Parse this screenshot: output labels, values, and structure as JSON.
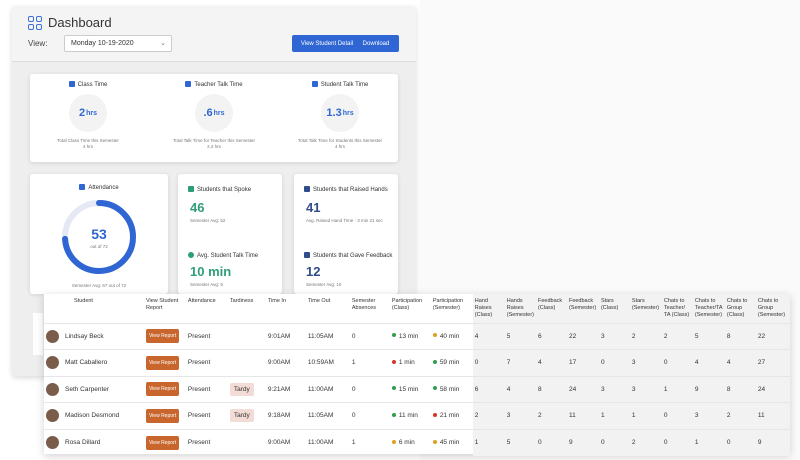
{
  "header": {
    "title": "Dashboard",
    "view_label": "View:",
    "view_value": "Monday 10-19-2020",
    "view_student_detail": "View Student Detail",
    "download": "Download"
  },
  "summary": [
    {
      "label": "Class Time",
      "value": "2",
      "unit": "hrs",
      "sub1": "Total Class Time this Semester",
      "sub2": "4 hrs",
      "icon": "calendar-icon"
    },
    {
      "label": "Teacher Talk Time",
      "value": ".6",
      "unit": "hrs",
      "sub1": "Total Talk Time for Teacher this Semester",
      "sub2": "2.2 hrs",
      "icon": "teacher-icon"
    },
    {
      "label": "Student Talk Time",
      "value": "1.3",
      "unit": "hrs",
      "sub1": "Total Talk Time for Students this Semester",
      "sub2": "4 hrs",
      "icon": "student-icon"
    }
  ],
  "attendance": {
    "label": "Attendance",
    "value": "53",
    "of": "out of 72",
    "sub": "Semester Avg: 67 out of 72",
    "fraction": 0.74,
    "color": "#2f66d4"
  },
  "spoke": {
    "label": "Students that Spoke",
    "value": "46",
    "sub": "Semester Avg: 52",
    "color": "#2e9e78"
  },
  "talk_time": {
    "label": "Avg. Student Talk Time",
    "value": "10 min",
    "sub": "Semester Avg: 9",
    "color": "#2e9e78"
  },
  "hands": {
    "label": "Students that Raised Hands",
    "value": "41",
    "sub": "Avg. Raised Hand Time - 3 min 21 sec",
    "color": "#2f4d8a"
  },
  "feedback": {
    "label": "Students that Gave Feedback",
    "value": "12",
    "sub": "Semester Avg: 10",
    "color": "#2f4d8a"
  },
  "table": {
    "columns": [
      "Student",
      "View Student Report",
      "Attendance",
      "Tardiness",
      "Time In",
      "Time Out",
      "Semester Absences",
      "Participation (Class)",
      "Participation (Semester)",
      "Hand Raises (Class)",
      "Hands Raises (Semester)",
      "Feedback (Class)",
      "Feedback (Semester)",
      "Stars (Class)",
      "Stars (Semester)",
      "Chats to Teacher/ TA (Class)",
      "Chats to Teacher/TA (Semester)",
      "Chats to Group (Class)",
      "Chats to Group (Semester)"
    ],
    "rows": [
      {
        "name": "Lindsay Beck",
        "report": "View Report",
        "attendance": "Present",
        "tardy": "",
        "time_in": "9:01AM",
        "time_out": "11:05AM",
        "absences": "0",
        "part_class": "13 min",
        "part_class_color": "#2e9e4f",
        "part_sem": "40 min",
        "part_sem_color": "#e0a020",
        "hr_c": "4",
        "hr_s": "5",
        "fb_c": "6",
        "fb_s": "22",
        "st_c": "3",
        "st_s": "2",
        "ct_c": "2",
        "ct_s": "5",
        "cg_c": "8",
        "cg_s": "22"
      },
      {
        "name": "Matt Caballero",
        "report": "View Report",
        "attendance": "Present",
        "tardy": "",
        "time_in": "9:00AM",
        "time_out": "10:59AM",
        "absences": "1",
        "part_class": "1 min",
        "part_class_color": "#d8342c",
        "part_sem": "59 min",
        "part_sem_color": "#2e9e4f",
        "hr_c": "0",
        "hr_s": "7",
        "fb_c": "4",
        "fb_s": "17",
        "st_c": "0",
        "st_s": "3",
        "ct_c": "0",
        "ct_s": "4",
        "cg_c": "4",
        "cg_s": "27"
      },
      {
        "name": "Seth Carpenter",
        "report": "View Report",
        "attendance": "Present",
        "tardy": "Tardy",
        "time_in": "9:21AM",
        "time_out": "11:00AM",
        "absences": "0",
        "part_class": "15 min",
        "part_class_color": "#2e9e4f",
        "part_sem": "58 min",
        "part_sem_color": "#2e9e4f",
        "hr_c": "6",
        "hr_s": "4",
        "fb_c": "8",
        "fb_s": "24",
        "st_c": "3",
        "st_s": "3",
        "ct_c": "1",
        "ct_s": "9",
        "cg_c": "8",
        "cg_s": "24"
      },
      {
        "name": "Madison Desmond",
        "report": "View Report",
        "attendance": "Present",
        "tardy": "Tardy",
        "time_in": "9:18AM",
        "time_out": "11:05AM",
        "absences": "0",
        "part_class": "11 min",
        "part_class_color": "#2e9e4f",
        "part_sem": "21 min",
        "part_sem_color": "#d8342c",
        "hr_c": "2",
        "hr_s": "3",
        "fb_c": "2",
        "fb_s": "11",
        "st_c": "1",
        "st_s": "1",
        "ct_c": "0",
        "ct_s": "3",
        "cg_c": "2",
        "cg_s": "11"
      },
      {
        "name": "Rosa Dillard",
        "report": "View Report",
        "attendance": "Present",
        "tardy": "",
        "time_in": "9:00AM",
        "time_out": "11:00AM",
        "absences": "1",
        "part_class": "6 min",
        "part_class_color": "#e0a020",
        "part_sem": "45 min",
        "part_sem_color": "#e0a020",
        "hr_c": "1",
        "hr_s": "5",
        "fb_c": "0",
        "fb_s": "9",
        "st_c": "0",
        "st_s": "2",
        "ct_c": "0",
        "ct_s": "1",
        "cg_c": "0",
        "cg_s": "9"
      }
    ]
  }
}
